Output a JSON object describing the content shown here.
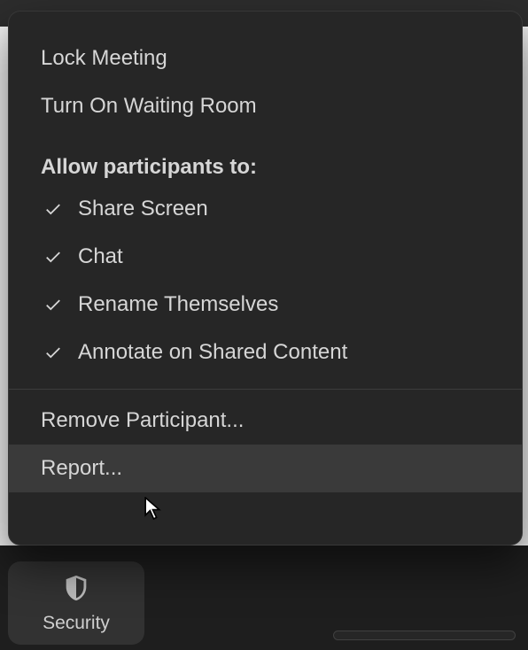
{
  "menu": {
    "lock_label": "Lock Meeting",
    "waiting_room_label": "Turn On Waiting Room",
    "allow_heading": "Allow participants to:",
    "options": [
      {
        "label": "Share Screen",
        "checked": true
      },
      {
        "label": "Chat",
        "checked": true
      },
      {
        "label": "Rename Themselves",
        "checked": true
      },
      {
        "label": "Annotate on Shared Content",
        "checked": true
      }
    ],
    "remove_label": "Remove Participant...",
    "report_label": "Report..."
  },
  "toolbar": {
    "security_label": "Security"
  }
}
